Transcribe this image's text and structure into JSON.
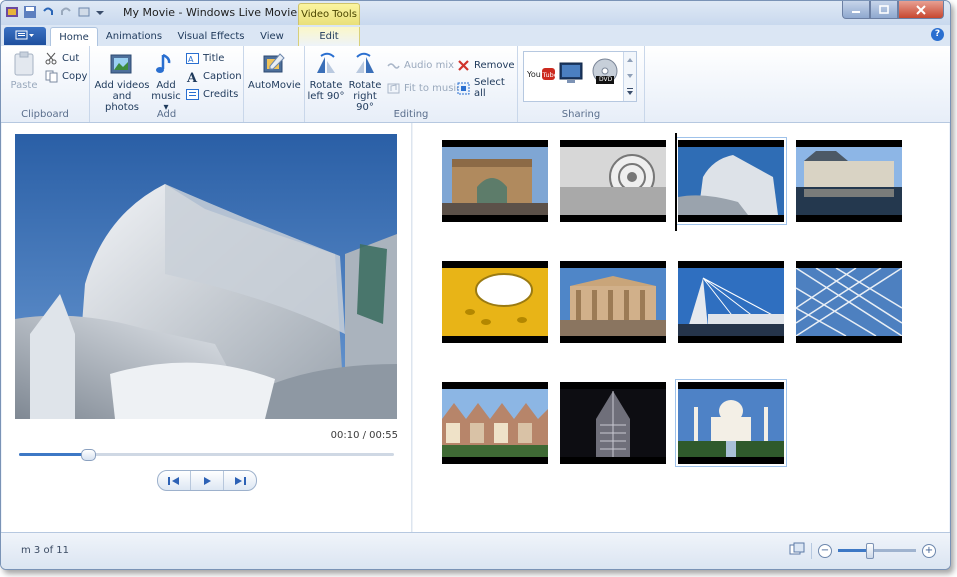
{
  "window": {
    "title": "My Movie - Windows Live Movie Maker"
  },
  "context_tab": {
    "label": "Video Tools"
  },
  "tabs": [
    {
      "label": "Home",
      "active": true
    },
    {
      "label": "Animations"
    },
    {
      "label": "Visual Effects"
    },
    {
      "label": "View"
    },
    {
      "label": "Edit"
    }
  ],
  "ribbon": {
    "clipboard": {
      "label": "Clipboard",
      "paste": "Paste",
      "cut": "Cut",
      "copy": "Copy"
    },
    "add": {
      "label": "Add",
      "add_videos_1": "Add videos",
      "add_videos_2": "and photos",
      "add_music_1": "Add",
      "add_music_2": "music ▾",
      "title": "Title",
      "caption": "Caption",
      "credits": "Credits"
    },
    "automovie": {
      "label": "AutoMovie"
    },
    "editing": {
      "label": "Editing",
      "rotate_left_1": "Rotate",
      "rotate_left_2": "left 90°",
      "rotate_right_1": "Rotate",
      "rotate_right_2": "right 90°",
      "audio_mix": "Audio mix",
      "fit_to_music": "Fit to music",
      "remove": "Remove",
      "select_all": "Select all"
    },
    "sharing": {
      "label": "Sharing",
      "youtube": "You Tube",
      "dvd": "DVD"
    }
  },
  "player": {
    "timecode": "00:10 / 00:55",
    "progress": 0.18
  },
  "storyboard": {
    "selected_index": 2,
    "items": [
      {
        "name": "arch"
      },
      {
        "name": "column"
      },
      {
        "name": "concert-hall"
      },
      {
        "name": "chateau"
      },
      {
        "name": "yellow-ceiling"
      },
      {
        "name": "parthenon"
      },
      {
        "name": "bridge"
      },
      {
        "name": "glass-roof"
      },
      {
        "name": "victorian-houses"
      },
      {
        "name": "skyscraper"
      },
      {
        "name": "taj-mahal"
      }
    ]
  },
  "status": {
    "text": "m 3 of 11"
  },
  "zoom": {
    "level": 0.4
  },
  "colors": {
    "accent": "#3d78c5",
    "video_tools": "#e9e07a",
    "sky": "#2f6db5"
  }
}
